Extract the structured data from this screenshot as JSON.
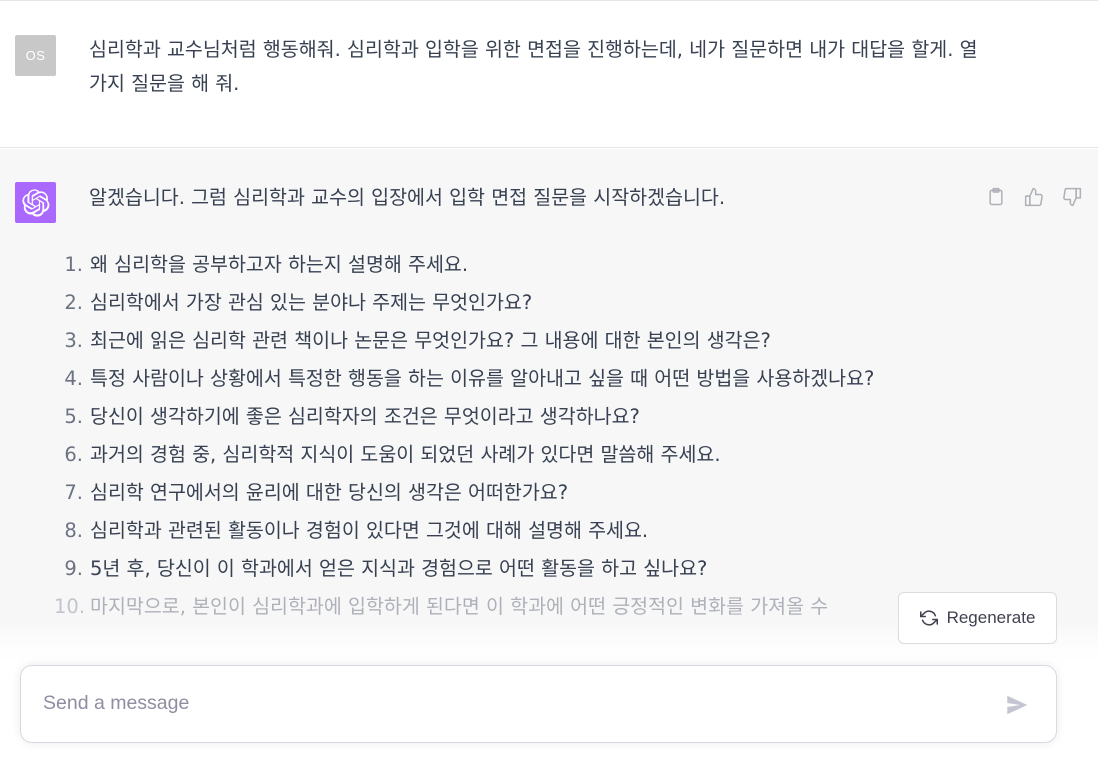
{
  "user_message": {
    "avatar_initials": "OS",
    "text": "심리학과 교수님처럼 행동해줘. 심리학과 입학을 위한 면접을 진행하는데, 네가 질문하면 내가 대답을 할게. 열 가지 질문을 해 줘."
  },
  "assistant_message": {
    "avatar_icon": "openai-logo-icon",
    "avatar_color": "#ab68ff",
    "intro": "알겠습니다. 그럼 심리학과 교수의 입장에서 입학 면접 질문을 시작하겠습니다.",
    "questions": [
      {
        "num": "1.",
        "text": "왜 심리학을 공부하고자 하는지 설명해 주세요."
      },
      {
        "num": "2.",
        "text": "심리학에서 가장 관심 있는 분야나 주제는 무엇인가요?"
      },
      {
        "num": "3.",
        "text": "최근에 읽은 심리학 관련 책이나 논문은 무엇인가요? 그 내용에 대한 본인의 생각은?"
      },
      {
        "num": "4.",
        "text": "특정 사람이나 상황에서 특정한 행동을 하는 이유를 알아내고 싶을 때 어떤 방법을 사용하겠나요?"
      },
      {
        "num": "5.",
        "text": "당신이 생각하기에 좋은 심리학자의 조건은 무엇이라고 생각하나요?"
      },
      {
        "num": "6.",
        "text": "과거의 경험 중, 심리학적 지식이 도움이 되었던 사례가 있다면 말씀해 주세요."
      },
      {
        "num": "7.",
        "text": "심리학 연구에서의 윤리에 대한 당신의 생각은 어떠한가요?"
      },
      {
        "num": "8.",
        "text": "심리학과 관련된 활동이나 경험이 있다면 그것에 대해 설명해 주세요."
      },
      {
        "num": "9.",
        "text": "5년 후, 당신이 이 학과에서 얻은 지식과 경험으로 어떤 활동을 하고 싶나요?"
      },
      {
        "num": "10.",
        "text": "마지막으로, 본인이 심리학과에 입학하게 된다면 이 학과에 어떤 긍정적인 변화를 가져올 수"
      }
    ],
    "actions": [
      "clipboard-icon",
      "thumbs-up-icon",
      "thumbs-down-icon"
    ]
  },
  "regenerate": {
    "label": "Regenerate",
    "icon": "refresh-icon"
  },
  "composer": {
    "placeholder": "Send a message",
    "send_icon": "send-icon"
  }
}
